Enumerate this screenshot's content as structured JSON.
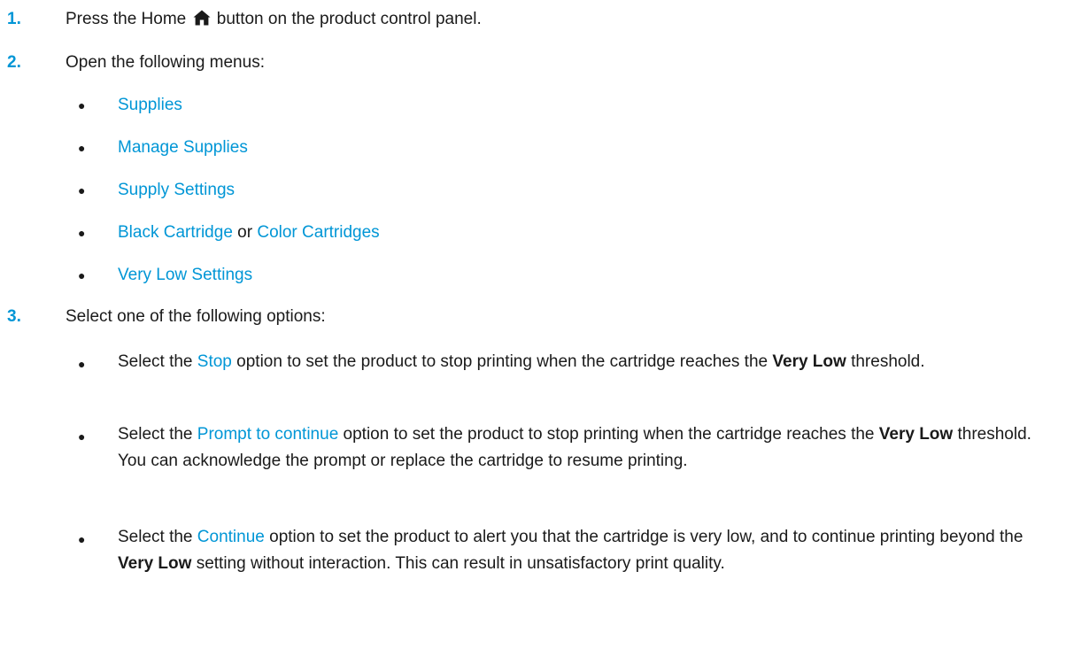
{
  "steps": [
    {
      "number": "1.",
      "text_before_icon": "Press the Home",
      "icon": "home-icon",
      "text_after_icon": "button on the product control panel."
    },
    {
      "number": "2.",
      "text": "Open the following menus:",
      "menus": [
        "Supplies",
        "Manage Supplies",
        "Supply Settings"
      ],
      "cartridge_a": "Black Cartridge",
      "cartridge_or": "or",
      "cartridge_b": "Color Cartridges",
      "last_menu": "Very Low Settings"
    },
    {
      "number": "3.",
      "text": "Select one of the following options:",
      "options": [
        {
          "pre": "Select the",
          "option": "Stop",
          "mid": "option to set the product to stop printing when the cartridge reaches the",
          "bold": "Very Low",
          "post": "threshold."
        },
        {
          "pre": "Select the",
          "option": "Prompt to continue",
          "mid": "option to set the product to stop printing when the cartridge reaches the",
          "bold": "Very Low",
          "post": "threshold. You can acknowledge the prompt or replace the cartridge to resume printing."
        },
        {
          "pre": "Select the",
          "option": "Continue",
          "mid": "option to set the product to alert you that the cartridge is very low, and to continue printing beyond the",
          "bold": "Very Low",
          "post": "setting without interaction. This can result in unsatisfactory print quality."
        }
      ]
    }
  ],
  "bullet_glyph": "●",
  "colors": {
    "accent": "#0096d6",
    "text": "#1a1a1a"
  }
}
